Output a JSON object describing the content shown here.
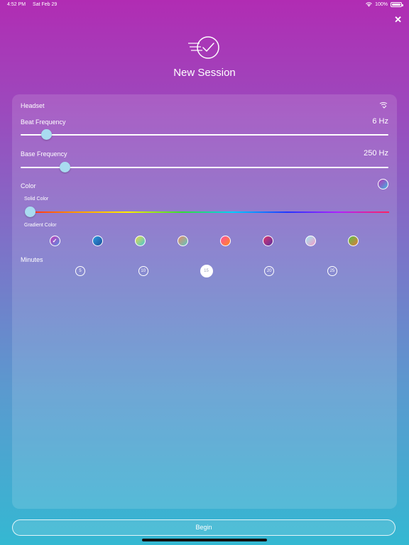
{
  "status": {
    "time": "4:52 PM",
    "date": "Sat Feb 29",
    "battery": "100%"
  },
  "header": {
    "title": "New Session",
    "close_icon": "close-icon",
    "logo_icon": "speed-check-icon"
  },
  "settings": {
    "headset": {
      "label": "Headset",
      "icon": "headset-signal-icon"
    },
    "beat_frequency": {
      "label": "Beat Frequency",
      "value": "6 Hz",
      "fraction": 0.07
    },
    "base_frequency": {
      "label": "Base Frequency",
      "value": "250 Hz",
      "fraction": 0.12
    },
    "color": {
      "label": "Color",
      "solid_label": "Solid Color",
      "gradient_label": "Gradient Color",
      "solid_fraction": 0.0,
      "gradients": [
        {
          "from": "#c23bb8",
          "to": "#5b8fe0",
          "selected": true
        },
        {
          "from": "#2d9be0",
          "to": "#1c4f9a",
          "selected": false
        },
        {
          "from": "#e8d84a",
          "to": "#48c6d6",
          "selected": false
        },
        {
          "from": "#e58a6a",
          "to": "#5fc6c0",
          "selected": false
        },
        {
          "from": "#ff4fa0",
          "to": "#ff8a20",
          "selected": false
        },
        {
          "from": "#e0356a",
          "to": "#5a2fa0",
          "selected": false
        },
        {
          "from": "#9fe4f0",
          "to": "#f29ac8",
          "selected": false
        },
        {
          "from": "#5bbf4a",
          "to": "#e07a3a",
          "selected": false
        }
      ]
    },
    "minutes": {
      "label": "Minutes",
      "options": [
        "5",
        "10",
        "15",
        "20",
        "25"
      ],
      "selected": "15"
    }
  },
  "footer": {
    "begin_label": "Begin"
  }
}
